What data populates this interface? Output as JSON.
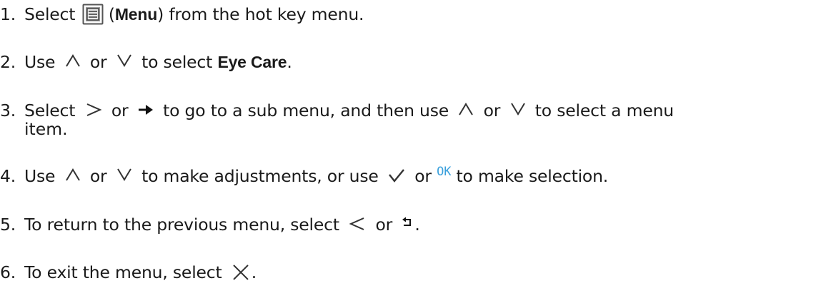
{
  "steps": [
    {
      "num": "1.",
      "parts": {
        "a": "Select",
        "b": "(",
        "bold": "Menu",
        "c": ") from the hot key menu."
      },
      "icons": [
        "menu-key-icon"
      ]
    },
    {
      "num": "2.",
      "parts": {
        "a": "Use",
        "or": "or",
        "b": "to select",
        "bold": "Eye Care",
        "c": "."
      },
      "icons": [
        "up-icon",
        "down-icon"
      ]
    },
    {
      "num": "3.",
      "parts": {
        "a": "Select",
        "or1": "or",
        "b": "to go to a sub menu, and then use",
        "or2": "or",
        "c": "to select a menu",
        "d": "item."
      },
      "icons": [
        "right-icon",
        "right-arrow-icon",
        "up-icon",
        "down-icon"
      ]
    },
    {
      "num": "4.",
      "parts": {
        "a": "Use",
        "or1": "or",
        "b": "to make adjustments, or use",
        "or2": "or",
        "ok": "OK",
        "c": "to make selection."
      },
      "icons": [
        "up-icon",
        "down-icon",
        "check-icon",
        "ok-icon"
      ]
    },
    {
      "num": "5.",
      "parts": {
        "a": "To return to the previous menu, select",
        "or": "or",
        "c": "."
      },
      "icons": [
        "left-icon",
        "back-icon"
      ]
    },
    {
      "num": "6.",
      "parts": {
        "a": "To exit the menu, select",
        "c": "."
      },
      "icons": [
        "close-icon"
      ]
    }
  ]
}
